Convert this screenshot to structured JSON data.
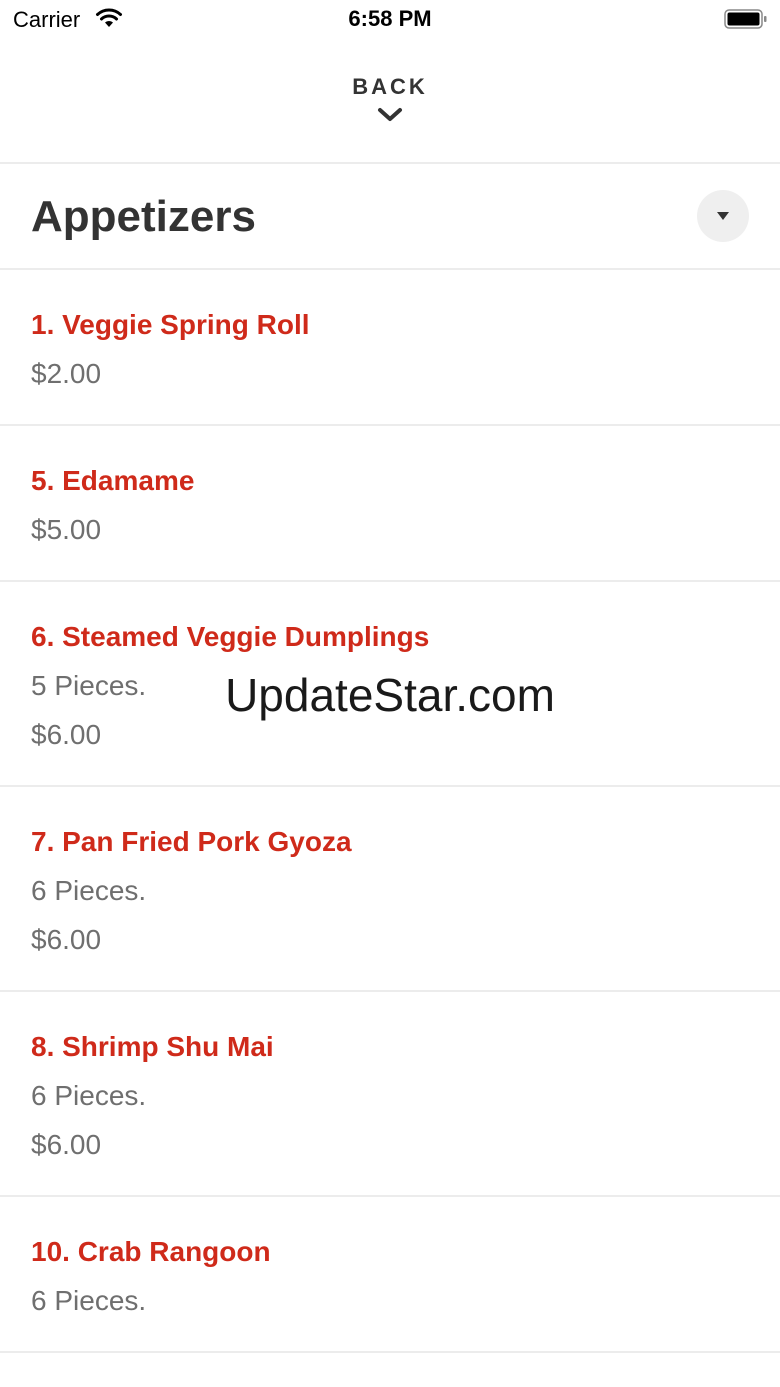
{
  "status_bar": {
    "carrier": "Carrier",
    "time": "6:58 PM",
    "icons": [
      "wifi-icon",
      "battery-icon"
    ]
  },
  "header": {
    "back_label": "BACK",
    "back_icon": "chevron-down-icon"
  },
  "category": {
    "title": "Appetizers",
    "dropdown_icon": "caret-down-icon"
  },
  "colors": {
    "item_name": "#cf2a1a",
    "secondary_text": "#6f6f6f",
    "title_text": "#333333"
  },
  "items": [
    {
      "name": "1. Veggie Spring Roll",
      "description": "",
      "price": "$2.00"
    },
    {
      "name": "5. Edamame",
      "description": "",
      "price": "$5.00"
    },
    {
      "name": "6. Steamed Veggie Dumplings",
      "description": "5 Pieces.",
      "price": "$6.00"
    },
    {
      "name": "7. Pan Fried Pork Gyoza",
      "description": "6 Pieces.",
      "price": "$6.00"
    },
    {
      "name": "8. Shrimp Shu Mai",
      "description": "6 Pieces.",
      "price": "$6.00"
    },
    {
      "name": "10. Crab Rangoon",
      "description": "6 Pieces.",
      "price": ""
    }
  ],
  "watermark": "UpdateStar.com"
}
